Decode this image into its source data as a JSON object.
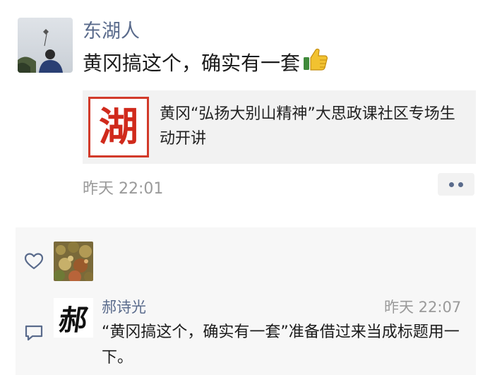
{
  "post": {
    "author": "东湖人",
    "text": "黄冈搞这个，确实有一套",
    "emoji": "thumbs-up",
    "time": "昨天 22:01",
    "link": {
      "thumb_char": "湖",
      "title": "黄冈“弘扬大别山精神”大思政课社区专场生动开讲"
    }
  },
  "comment": {
    "name": "郝诗光",
    "avatar_char": "郝",
    "time": "昨天 22:07",
    "text": "“黄冈搞这个，确实有一套”准备借过来当成标题用一下。"
  },
  "colors": {
    "link_name": "#5a6b8c",
    "time": "#9a9a9a",
    "card_bg": "#f2f2f2",
    "panel_bg": "#f7f7f7",
    "seal_red": "#d23a2a"
  },
  "icons": [
    "heart-icon",
    "comment-icon",
    "more-icon",
    "thumbs-up-icon"
  ]
}
